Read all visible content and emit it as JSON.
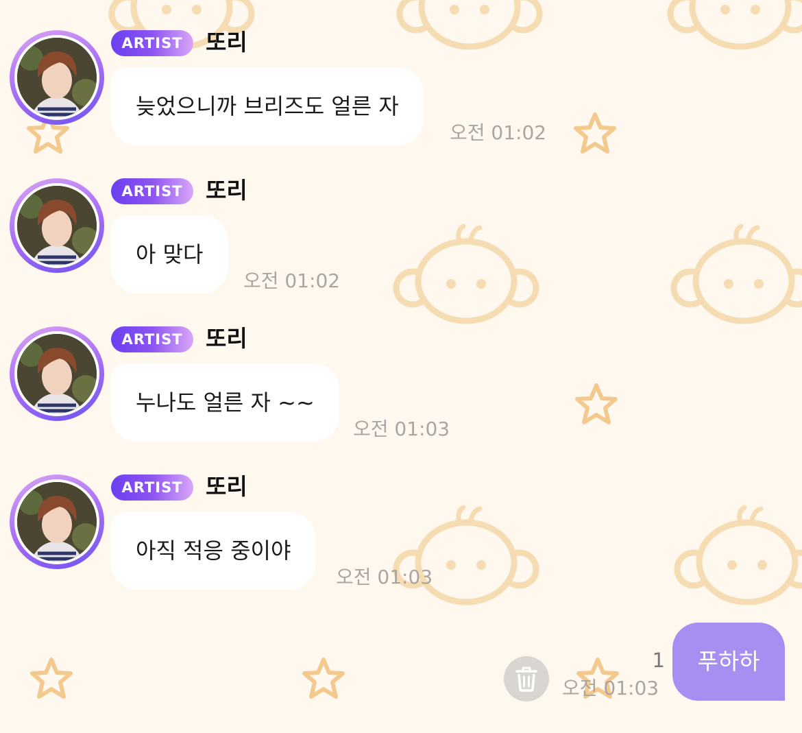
{
  "messages": [
    {
      "badge": "ARTIST",
      "sender": "또리",
      "text": "늦었으니까 브리즈도 얼른 자",
      "time": "오전 01:02"
    },
    {
      "badge": "ARTIST",
      "sender": "또리",
      "text": "아 맞다",
      "time": "오전 01:02"
    },
    {
      "badge": "ARTIST",
      "sender": "또리",
      "text": "누나도 얼른 자 ~~",
      "time": "오전 01:03"
    },
    {
      "badge": "ARTIST",
      "sender": "또리",
      "text": "아직 적응 중이야",
      "time": "오전 01:03"
    }
  ],
  "my_message": {
    "text": "푸하하",
    "time": "오전 01:03",
    "unread_count": "1"
  },
  "icons": {
    "delete": "trash-icon",
    "background_pattern": [
      "monkey-face-icon",
      "star-icon"
    ]
  },
  "colors": {
    "background": "#fff8ef",
    "my_bubble": "#a78ff1",
    "badge_start": "#6a3ff2",
    "badge_end": "#d9a6f8",
    "pattern": "#f5dcb3"
  }
}
